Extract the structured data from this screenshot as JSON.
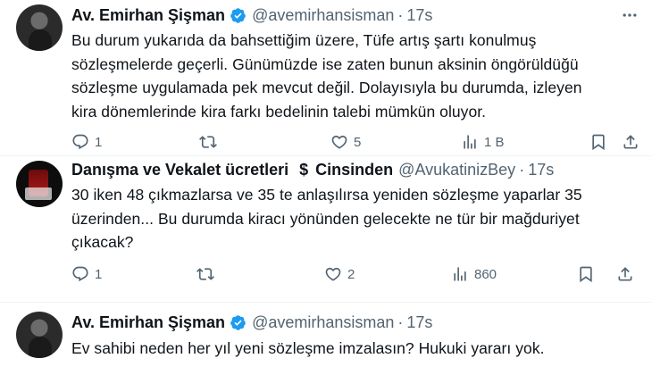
{
  "tweets": [
    {
      "name": "Av. Emirhan Şişman",
      "handle": "@avemirhansisman",
      "dot": "·",
      "time": "17s",
      "lines": [
        "Bu durum yukarıda da bahsettiğim üzere, Tüfe artış şartı konulmuş",
        "sözleşmelerde geçerli. Günümüzde ise zaten bunun aksinin öngörüldüğü",
        "sözleşme uygulamada pek mevcut değil. Dolayısıyla bu durumda, izleyen",
        "kira dönemlerinde kira farkı bedelinin talebi mümkün oluyor."
      ],
      "replies": "1",
      "reposts": "",
      "likes": "5",
      "views": "1 B"
    },
    {
      "name": "Danışma ve Vekalet ücretleri",
      "name_symbol": "$",
      "name_suffix": "Cinsinden",
      "handle": "@AvukatinizBey",
      "dot": "·",
      "time": "17s",
      "lines": [
        "30 iken 48 çıkmazlarsa ve 35 te anlaşılırsa yeniden sözleşme yaparlar 35",
        "üzerinden... Bu durumda kiracı yönünden gelecekte ne tür bir mağduriyet",
        "çıkacak?"
      ],
      "replies": "1",
      "reposts": "",
      "likes": "2",
      "views": "860"
    },
    {
      "name": "Av. Emirhan Şişman",
      "handle": "@avemirhansisman",
      "dot": "·",
      "time": "17s",
      "lines": [
        "Ev sahibi neden her yıl yeni sözleşme imzalasın? Hukuki yararı yok."
      ]
    }
  ],
  "colors": {
    "verified": "#1d9bf0",
    "muted": "#536471",
    "text": "#0f1419"
  },
  "icons": [
    "more-icon",
    "verified-icon",
    "reply-icon",
    "repost-icon",
    "like-icon",
    "views-icon",
    "bookmark-icon",
    "share-icon"
  ]
}
